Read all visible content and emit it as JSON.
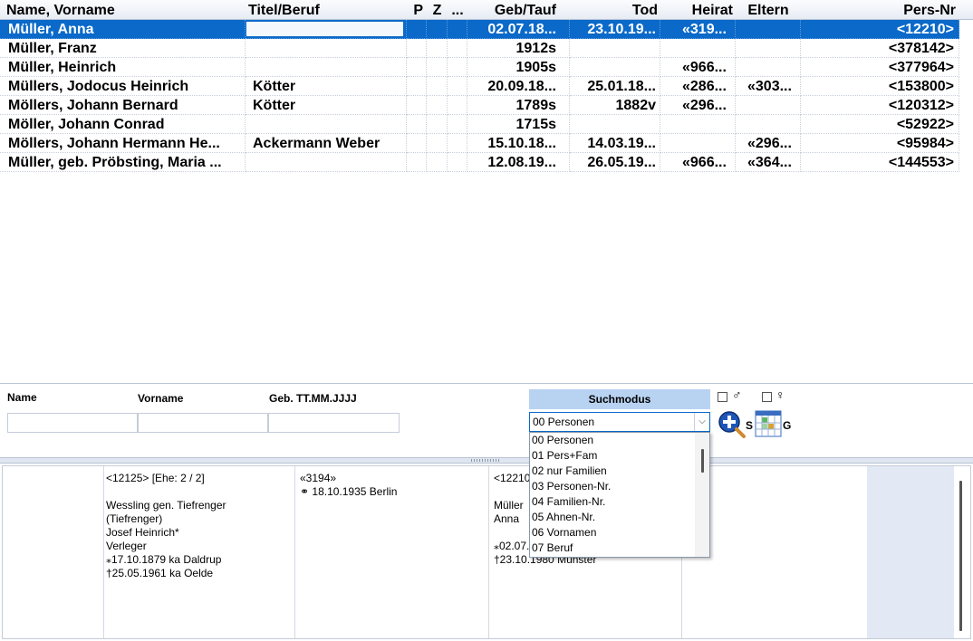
{
  "grid": {
    "headers": {
      "name": "Name, Vorname",
      "titel": "Titel/Beruf",
      "p": "P",
      "z": "Z",
      "x": "...",
      "geb": "Geb/Tauf",
      "tod": "Tod",
      "heirat": "Heirat",
      "eltern": "Eltern",
      "pers": "Pers-Nr"
    },
    "rows": [
      {
        "name": "Müller, Anna",
        "titel": "",
        "geb": "02.07.18...",
        "tod": "23.10.19...",
        "heirat": "«319...",
        "eltern": "",
        "pers": "<12210>"
      },
      {
        "name": "Müller, Franz",
        "titel": "",
        "geb": "1912s",
        "tod": "",
        "heirat": "",
        "eltern": "",
        "pers": "<378142>"
      },
      {
        "name": "Müller, Heinrich",
        "titel": "",
        "geb": "1905s",
        "tod": "",
        "heirat": "«966...",
        "eltern": "",
        "pers": "<377964>"
      },
      {
        "name": "Müllers, Jodocus Heinrich",
        "titel": "Kötter",
        "geb": "20.09.18...",
        "tod": "25.01.18...",
        "heirat": "«286...",
        "eltern": "«303...",
        "pers": "<153800>"
      },
      {
        "name": "Möllers, Johann Bernard",
        "titel": "Kötter",
        "geb": "1789s",
        "tod": "1882v",
        "heirat": "«296...",
        "eltern": "",
        "pers": "<120312>"
      },
      {
        "name": "Möller, Johann Conrad",
        "titel": "",
        "geb": "1715s",
        "tod": "",
        "heirat": "",
        "eltern": "",
        "pers": "<52922>"
      },
      {
        "name": "Möllers, Johann Hermann He...",
        "titel": "Ackermann Weber",
        "geb": "15.10.18...",
        "tod": "14.03.19...",
        "heirat": "",
        "eltern": "«296...",
        "pers": "<95984>"
      },
      {
        "name": "Müller, geb. Pröbsting, Maria ...",
        "titel": "",
        "geb": "12.08.19...",
        "tod": "26.05.19...",
        "heirat": "«966...",
        "eltern": "«364...",
        "pers": "<144553>"
      }
    ],
    "selected_index": 0
  },
  "search": {
    "label_name": "Name",
    "label_vorname": "Vorname",
    "label_geb": "Geb. TT.MM.JJJJ",
    "name_value": "",
    "vorname_value": "",
    "geb_value": "",
    "suchmodus_label": "Suchmodus",
    "selected_mode": "00 Personen",
    "male_symbol": "♂",
    "female_symbol": "♀",
    "search_btn_label": "S",
    "grid_btn_label": "G",
    "modes": [
      "00 Personen",
      "01 Pers+Fam",
      "02 nur Familien",
      "03 Personen-Nr.",
      "04 Familien-Nr.",
      "05 Ahnen-Nr.",
      "06 Vornamen",
      "07 Beruf"
    ]
  },
  "family": {
    "husband": {
      "header": "<12125>  [Ehe: 2 / 2]",
      "name1": "Wessling gen. Tiefrenger",
      "name2": "(Tiefrenger)",
      "given": "Josef Heinrich*",
      "occupation": "Verleger",
      "birth": "⁎17.10.1879 ka Daldrup",
      "death": "†25.05.1961 ka Oelde"
    },
    "marriage": {
      "header": "«3194»",
      "date": "⚭ 18.10.1935 Berlin"
    },
    "wife": {
      "header": "<12210>",
      "surname": "Müller",
      "given": "Anna",
      "birth": "⁎02.07.1898 Münster",
      "death": "†23.10.1980 Münster"
    }
  },
  "colors": {
    "selection": "#0a69c9",
    "suchmodus_bg": "#b8d2f2",
    "panel_shade": "#e2e8f4"
  }
}
